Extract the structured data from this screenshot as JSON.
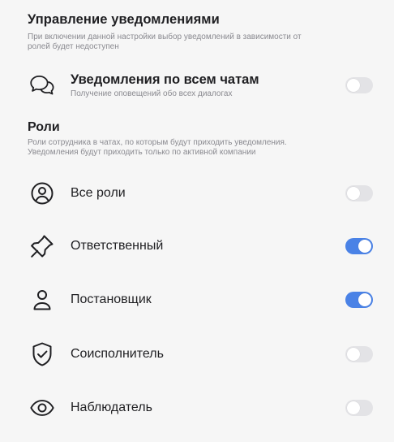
{
  "header": {
    "title": "Управление уведомлениями",
    "subtitle_lines": [
      "При включении данной настройки выбор уведомлений в зависимости от",
      "ролей будет недоступен"
    ]
  },
  "all_chats": {
    "title": "Уведомления по всем чатам",
    "subtitle": "Получение оповещений обо всех диалогах",
    "icon": "chat-bubbles-icon",
    "enabled": false
  },
  "roles_section": {
    "title": "Роли",
    "subtitle_lines": [
      "Роли сотрудника в чатах, по которым будут приходить уведомления.",
      "Уведомления будут приходить только по активной компании"
    ]
  },
  "roles": [
    {
      "label": "Все роли",
      "icon": "user-circle-icon",
      "enabled": false
    },
    {
      "label": "Ответственный",
      "icon": "pin-icon",
      "enabled": true
    },
    {
      "label": "Постановщик",
      "icon": "user-icon",
      "enabled": true
    },
    {
      "label": "Соисполнитель",
      "icon": "shield-check-icon",
      "enabled": false
    },
    {
      "label": "Наблюдатель",
      "icon": "eye-icon",
      "enabled": false
    }
  ],
  "colors": {
    "accent": "#4a82e6",
    "toggle_off": "#e3e3e6",
    "background": "#f6f6f6"
  }
}
